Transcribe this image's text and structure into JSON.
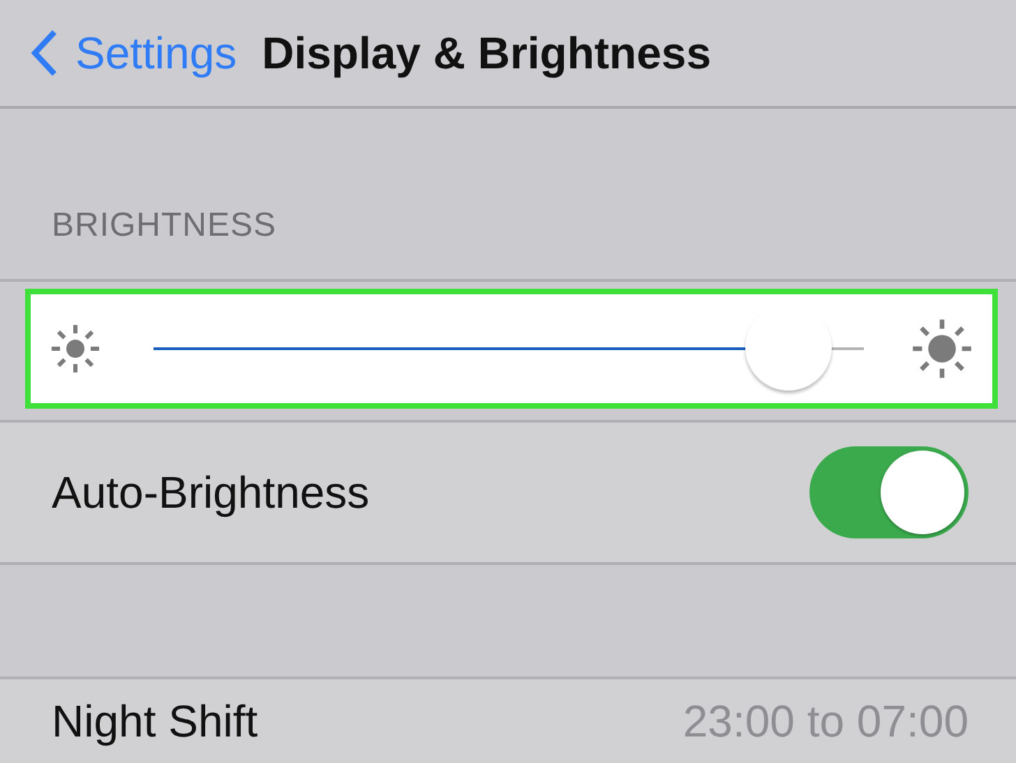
{
  "nav": {
    "back": "Settings",
    "title": "Display & Brightness"
  },
  "section_header": "BRIGHTNESS",
  "brightness_slider": {
    "level": 0.94,
    "highlighted": true
  },
  "rows": [
    {
      "kind": "toggle",
      "label": "Auto-Brightness",
      "on": true
    },
    {
      "kind": "spacer"
    },
    {
      "kind": "value",
      "label": "Night Shift",
      "value": "23:00 to 07:00"
    }
  ]
}
